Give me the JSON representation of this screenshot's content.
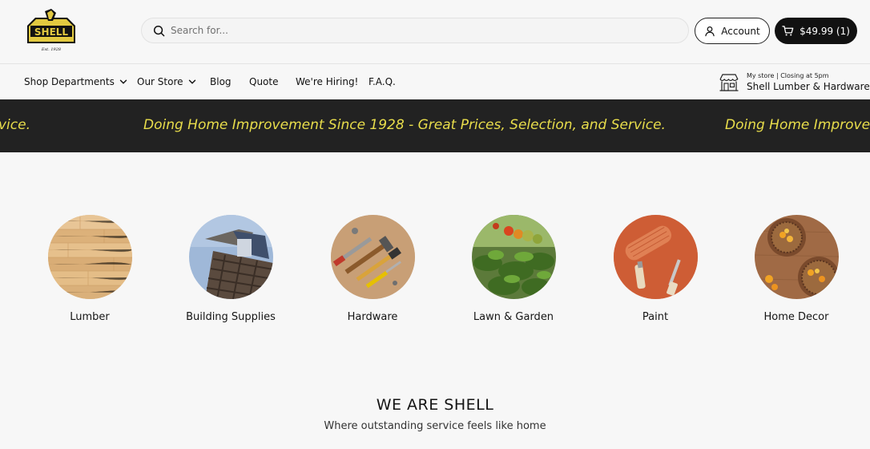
{
  "brand": {
    "logo_text": "SHELL",
    "logo_tagline": "LUMBER, HARDWARE & PAINT",
    "logo_est": "Est. 1928"
  },
  "search": {
    "placeholder": "Search for..."
  },
  "account": {
    "label": "Account",
    "icon": "user-icon"
  },
  "cart": {
    "label": "$49.99 (1)",
    "icon": "cart-icon"
  },
  "nav": {
    "items": [
      {
        "label": "Shop Departments",
        "has_dropdown": true
      },
      {
        "label": "Our Store",
        "has_dropdown": true
      },
      {
        "label": "Blog",
        "has_dropdown": false
      },
      {
        "label": "Quote",
        "has_dropdown": false
      },
      {
        "label": "We're Hiring!",
        "has_dropdown": false
      },
      {
        "label": "F.A.Q.",
        "has_dropdown": false
      }
    ]
  },
  "store": {
    "meta": "My store  |  Closing at 5pm",
    "name": "Shell Lumber & Hardware",
    "icon": "store-icon"
  },
  "banner": {
    "text": "Doing Home Improvement Since 1928 - Great Prices, Selection, and Service.",
    "fragment_left": "vice.",
    "fragment_right": "Doing Home Improveme",
    "background": "#222222",
    "text_color": "#e8dd4b"
  },
  "categories": [
    {
      "label": "Lumber"
    },
    {
      "label": "Building Supplies"
    },
    {
      "label": "Hardware"
    },
    {
      "label": "Lawn & Garden"
    },
    {
      "label": "Paint"
    },
    {
      "label": "Home Decor"
    }
  ],
  "about": {
    "title": "WE ARE SHELL",
    "subtitle": "Where outstanding service feels like home"
  }
}
